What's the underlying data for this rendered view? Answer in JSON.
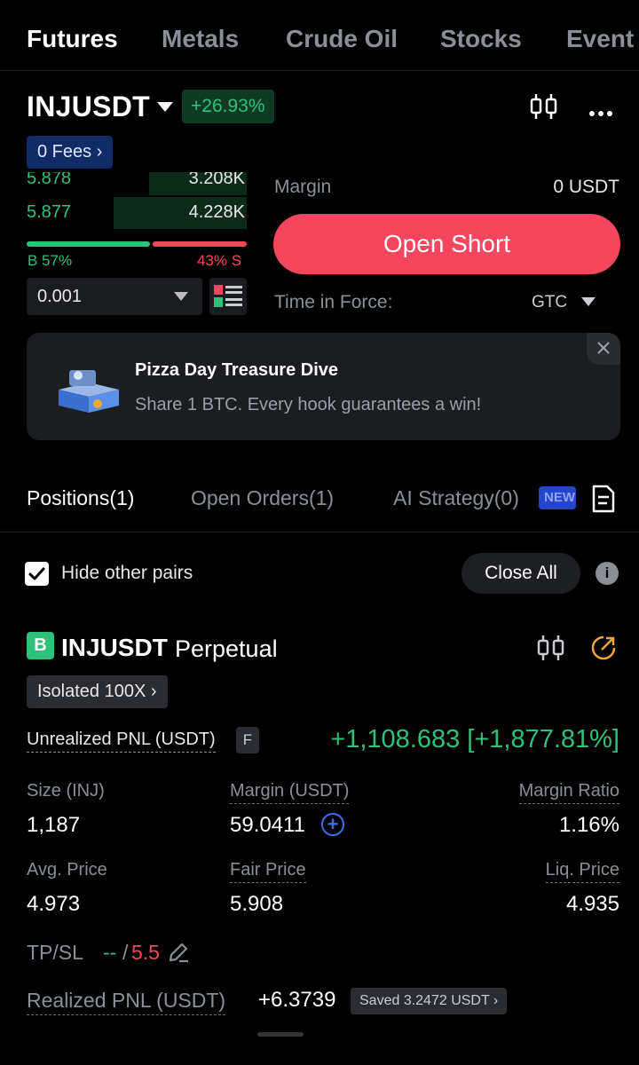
{
  "nav": {
    "tabs": [
      "Futures",
      "Metals",
      "Crude Oil",
      "Stocks",
      "Event"
    ],
    "active": "Futures"
  },
  "header": {
    "symbol": "INJUSDT",
    "change": "+26.93%",
    "fees": "0 Fees"
  },
  "orderbook": {
    "rows": [
      {
        "price": "5.878",
        "qty": "3.208K"
      },
      {
        "price": "5.877",
        "qty": "4.228K"
      }
    ],
    "buy_ratio": "B 57%",
    "sell_ratio": "43% S",
    "buy_fraction": 0.57,
    "quantity_step": "0.001"
  },
  "trade": {
    "margin_label": "Margin",
    "margin_value": "0 USDT",
    "open_short": "Open Short",
    "tif_label": "Time in Force:",
    "tif_value": "GTC"
  },
  "promo": {
    "title": "Pizza Day Treasure Dive",
    "subtitle": "Share 1 BTC. Every hook guarantees a win!"
  },
  "position_tabs": {
    "positions": "Positions(1)",
    "open_orders": "Open Orders(1)",
    "ai_strategy": "AI Strategy(0)",
    "new_badge": "NEW"
  },
  "filters": {
    "hide_other_pairs": "Hide other pairs",
    "hide_checked": true,
    "close_all": "Close All"
  },
  "position": {
    "side_badge": "B",
    "symbol": "INJUSDT",
    "type": "Perpetual",
    "mode": "Isolated 100X",
    "upnl_label": "Unrealized PNL (USDT)",
    "f_badge": "F",
    "upnl_value": "+1,108.683 [+1,877.81%]",
    "size_label": "Size (INJ)",
    "size_value": "1,187",
    "margin_label": "Margin (USDT)",
    "margin_value": "59.0411",
    "margin_ratio_label": "Margin Ratio",
    "margin_ratio_value": "1.16%",
    "avg_price_label": "Avg. Price",
    "avg_price_value": "4.973",
    "fair_price_label": "Fair Price",
    "fair_price_value": "5.908",
    "liq_price_label": "Liq. Price",
    "liq_price_value": "4.935",
    "tpsl_label": "TP/SL",
    "tp_value": "--",
    "sl_value": "5.5",
    "rpnl_label": "Realized PNL (USDT)",
    "rpnl_value": "+6.3739",
    "saved": "Saved 3.2472 USDT"
  },
  "colors": {
    "green": "#2fc17a",
    "red": "#f6465d",
    "blue": "#3d6cf0",
    "orange": "#f0a73a",
    "muted": "#8a8f98"
  }
}
